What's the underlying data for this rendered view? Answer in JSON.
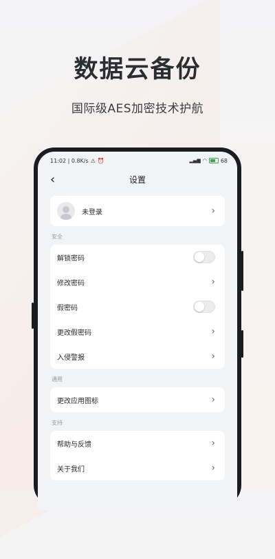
{
  "promo": {
    "headline": "数据云备份",
    "subline": "国际级AES加密技术护航"
  },
  "status_bar": {
    "time_speed": "11:02 | 0.8K/s ",
    "right_text": "68"
  },
  "navbar": {
    "back": "‹",
    "title": "设置"
  },
  "user": {
    "label": "未登录"
  },
  "sections": {
    "security": {
      "label": "安全",
      "items": [
        {
          "label": "解锁密码",
          "type": "toggle",
          "on": false
        },
        {
          "label": "修改密码",
          "type": "link"
        },
        {
          "label": "假密码",
          "type": "toggle",
          "on": false
        },
        {
          "label": "更改假密码",
          "type": "link"
        },
        {
          "label": "入侵警报",
          "type": "link"
        }
      ]
    },
    "general": {
      "label": "通用",
      "items": [
        {
          "label": "更改应用图标",
          "type": "link"
        }
      ]
    },
    "support": {
      "label": "支持",
      "items": [
        {
          "label": "帮助与反馈",
          "type": "link"
        },
        {
          "label": "关于我们",
          "type": "link"
        }
      ]
    }
  },
  "icons": {
    "chevron": "›"
  }
}
